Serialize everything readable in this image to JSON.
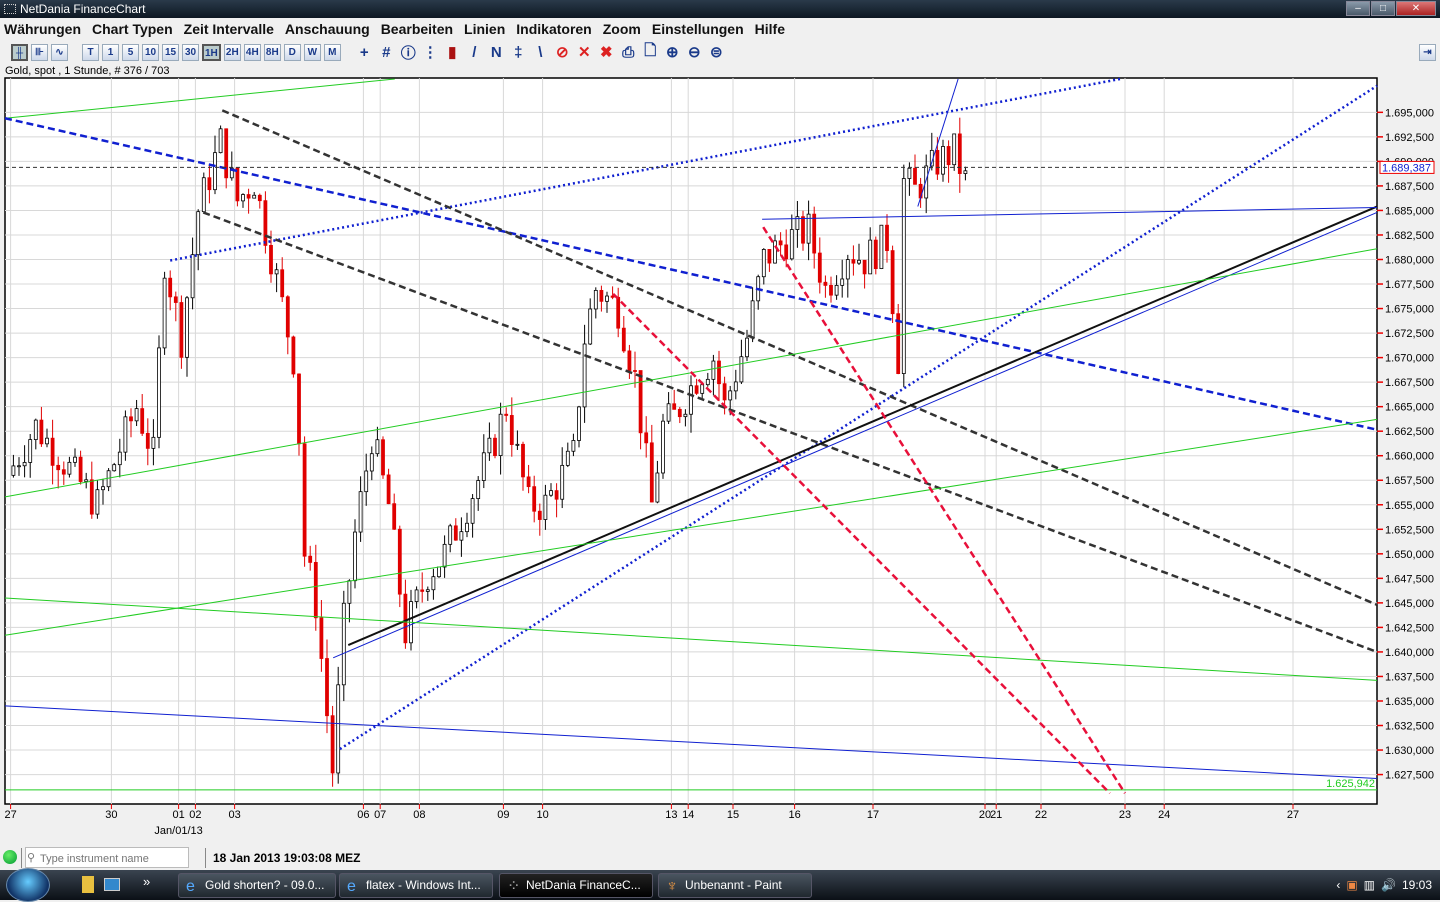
{
  "window": {
    "title": "NetDania FinanceChart",
    "min": "–",
    "max": "□",
    "close": "✕"
  },
  "menu": [
    "Währungen",
    "Chart Typen",
    "Zeit Intervalle",
    "Anschauung",
    "Bearbeiten",
    "Linien",
    "Indikatoren",
    "Zoom",
    "Einstellungen",
    "Hilfe"
  ],
  "toolbar": {
    "chart_types": [
      "candlestick-icon",
      "bar-chart-icon",
      "line-chart-icon"
    ],
    "intervals": [
      "T",
      "1",
      "5",
      "10",
      "15",
      "30",
      "1H",
      "2H",
      "4H",
      "8H",
      "D",
      "W",
      "M"
    ],
    "active_interval": "1H",
    "tools": [
      {
        "name": "crosshair-icon",
        "glyph": "+"
      },
      {
        "name": "grid-icon",
        "glyph": "#"
      },
      {
        "name": "info-icon",
        "glyph": "ⓘ"
      },
      {
        "name": "grid-lines-icon",
        "glyph": "⋮"
      },
      {
        "name": "volume-icon",
        "glyph": "▮"
      },
      {
        "name": "trendline-icon",
        "glyph": "/"
      },
      {
        "name": "trendline-2-icon",
        "glyph": "N"
      },
      {
        "name": "trendline-3-icon",
        "glyph": "‡"
      },
      {
        "name": "trendline-4-icon",
        "glyph": "\\"
      },
      {
        "name": "delete-line-icon",
        "glyph": "⊘"
      },
      {
        "name": "delete-icon",
        "glyph": "✕"
      },
      {
        "name": "delete-all-icon",
        "glyph": "✖"
      },
      {
        "name": "print-icon",
        "glyph": "⎙"
      },
      {
        "name": "print-preview-icon",
        "glyph": "🗋"
      },
      {
        "name": "zoom-in-icon",
        "glyph": "⊕"
      },
      {
        "name": "zoom-out-icon",
        "glyph": "⊖"
      },
      {
        "name": "zoom-reset-icon",
        "glyph": "⊜"
      }
    ]
  },
  "info_line": "Gold, spot , 1 Stunde, # 376 / 703",
  "status": {
    "search_placeholder": "Type instrument name",
    "timestamp": "18 Jan 2013 19:03:08 MEZ"
  },
  "taskbar": {
    "tasks": [
      "Gold shorten? - 09.0...",
      "flatex - Windows Int...",
      "NetDania FinanceC...",
      "Unbenannt - Paint"
    ],
    "time": "19:03"
  },
  "chart_data": {
    "type": "candlestick",
    "instrument": "Gold, spot",
    "interval": "1 Stunde",
    "ylim": [
      1.6245,
      1.6985
    ],
    "xlim": [
      0,
      245
    ],
    "y_ticks": [
      "1.695,000",
      "1.692,500",
      "1.690,000",
      "1.687,500",
      "1.685,000",
      "1.682,500",
      "1.680,000",
      "1.677,500",
      "1.675,000",
      "1.672,500",
      "1.670,000",
      "1.667,500",
      "1.665,000",
      "1.662,500",
      "1.660,000",
      "1.657,500",
      "1.655,000",
      "1.652,500",
      "1.650,000",
      "1.647,500",
      "1.645,000",
      "1.642,500",
      "1.640,000",
      "1.637,500",
      "1.635,000",
      "1.632,500",
      "1.630,000",
      "1.627,500"
    ],
    "y_tick_values": [
      1.695,
      1.6925,
      1.69,
      1.6875,
      1.685,
      1.6825,
      1.68,
      1.6775,
      1.675,
      1.6725,
      1.67,
      1.6675,
      1.665,
      1.6625,
      1.66,
      1.6575,
      1.655,
      1.6525,
      1.65,
      1.6475,
      1.645,
      1.6425,
      1.64,
      1.6375,
      1.635,
      1.6325,
      1.63,
      1.6275
    ],
    "x_ticks": [
      {
        "bar": 1,
        "label": "27"
      },
      {
        "bar": 19,
        "label": "30"
      },
      {
        "bar": 31,
        "label": "01"
      },
      {
        "bar": 34,
        "label": "02"
      },
      {
        "bar": 41,
        "label": "03"
      },
      {
        "bar": 64,
        "label": "06"
      },
      {
        "bar": 67,
        "label": "07"
      },
      {
        "bar": 74,
        "label": "08"
      },
      {
        "bar": 89,
        "label": "09"
      },
      {
        "bar": 96,
        "label": "10"
      },
      {
        "bar": 119,
        "label": "13"
      },
      {
        "bar": 122,
        "label": "14"
      },
      {
        "bar": 130,
        "label": "15"
      },
      {
        "bar": 141,
        "label": "16"
      },
      {
        "bar": 155,
        "label": "17"
      },
      {
        "bar": 175,
        "label": "20"
      },
      {
        "bar": 177,
        "label": "21"
      },
      {
        "bar": 185,
        "label": "22"
      },
      {
        "bar": 200,
        "label": "23"
      },
      {
        "bar": 207,
        "label": "24"
      },
      {
        "bar": 230,
        "label": "27"
      }
    ],
    "x_sublabel": {
      "bar": 31,
      "label": "Jan/01/13"
    },
    "current_price": 1.689387,
    "current_price_label": "1.689,387",
    "low_marker": 1.625942,
    "low_marker_label": "1.625,942",
    "price_path": [
      [
        1,
        1.658
      ],
      [
        6,
        1.663
      ],
      [
        17,
        1.655
      ],
      [
        24,
        1.665
      ],
      [
        27,
        1.66
      ],
      [
        29,
        1.68
      ],
      [
        32,
        1.672
      ],
      [
        35,
        1.685
      ],
      [
        39,
        1.692
      ],
      [
        42,
        1.686
      ],
      [
        45,
        1.688
      ],
      [
        49,
        1.678
      ],
      [
        52,
        1.67
      ],
      [
        53,
        1.662
      ],
      [
        54,
        1.65
      ],
      [
        56,
        1.645
      ],
      [
        59,
        1.628
      ],
      [
        61,
        1.643
      ],
      [
        63,
        1.652
      ],
      [
        66,
        1.662
      ],
      [
        69,
        1.655
      ],
      [
        72,
        1.642
      ],
      [
        76,
        1.648
      ],
      [
        79,
        1.65
      ],
      [
        83,
        1.655
      ],
      [
        87,
        1.66
      ],
      [
        90,
        1.665
      ],
      [
        94,
        1.655
      ],
      [
        97,
        1.655
      ],
      [
        102,
        1.66
      ],
      [
        104,
        1.672
      ],
      [
        106,
        1.677
      ],
      [
        110,
        1.675
      ],
      [
        113,
        1.668
      ],
      [
        116,
        1.655
      ],
      [
        118,
        1.663
      ],
      [
        120,
        1.664
      ],
      [
        124,
        1.668
      ],
      [
        127,
        1.67
      ],
      [
        129,
        1.665
      ],
      [
        133,
        1.672
      ],
      [
        136,
        1.68
      ],
      [
        140,
        1.682
      ],
      [
        144,
        1.683
      ],
      [
        147,
        1.677
      ],
      [
        151,
        1.681
      ],
      [
        154,
        1.68
      ],
      [
        158,
        1.682
      ],
      [
        160,
        1.67
      ],
      [
        161,
        1.688
      ],
      [
        163,
        1.687
      ],
      [
        167,
        1.69
      ],
      [
        170,
        1.691
      ],
      [
        172,
        1.688
      ]
    ],
    "lines": [
      {
        "from": [
          0,
          1.6944
        ],
        "to": [
          69.6,
          1.6984
        ],
        "color": "#22cc22",
        "style": "solid"
      },
      {
        "from": [
          0,
          1.6944
        ],
        "to": [
          244.6,
          1.6627
        ],
        "color": "#1020d0",
        "style": "dashed"
      },
      {
        "from": [
          29.5,
          1.6799
        ],
        "to": [
          199.1,
          1.6984
        ],
        "color": "#1020d0",
        "style": "dotted"
      },
      {
        "from": [
          59.8,
          1.6301
        ],
        "to": [
          245,
          1.6977
        ],
        "color": "#1020d0",
        "style": "dotted"
      },
      {
        "from": [
          38.8,
          1.6952
        ],
        "to": [
          245,
          1.6448
        ],
        "color": "#333333",
        "style": "dashed"
      },
      {
        "from": [
          35.4,
          1.6848
        ],
        "to": [
          245,
          1.64
        ],
        "color": "#333333",
        "style": "dashed"
      },
      {
        "from": [
          61.3,
          1.6407
        ],
        "to": [
          245,
          1.6854
        ],
        "color": "#111111",
        "style": "solid-thick"
      },
      {
        "from": [
          58.6,
          1.6394
        ],
        "to": [
          245,
          1.6848
        ],
        "color": "#1020d0",
        "style": "solid"
      },
      {
        "from": [
          135.2,
          1.6841
        ],
        "to": [
          245,
          1.6853
        ],
        "color": "#1020d0",
        "style": "solid"
      },
      {
        "from": [
          0,
          1.6558
        ],
        "to": [
          245,
          1.6811
        ],
        "color": "#22cc22",
        "style": "solid"
      },
      {
        "from": [
          0,
          1.6417
        ],
        "to": [
          245,
          1.6637
        ],
        "color": "#22cc22",
        "style": "solid"
      },
      {
        "from": [
          0,
          1.6455
        ],
        "to": [
          245,
          1.6371
        ],
        "color": "#22cc22",
        "style": "solid"
      },
      {
        "from": [
          0,
          1.6345
        ],
        "to": [
          245,
          1.6271
        ],
        "color": "#1020d0",
        "style": "solid"
      },
      {
        "from": [
          0,
          1.625942
        ],
        "to": [
          245,
          1.625942
        ],
        "color": "#22cc22",
        "style": "solid"
      },
      {
        "from": [
          108.6,
          1.6765
        ],
        "to": [
          197.3,
          1.6256
        ],
        "color": "#e8103a",
        "style": "dashed"
      },
      {
        "from": [
          135.4,
          1.6833
        ],
        "to": [
          200,
          1.6256
        ],
        "color": "#e8103a",
        "style": "dashed"
      },
      {
        "from": [
          163,
          1.6854
        ],
        "to": [
          170.2,
          1.6984
        ],
        "color": "#1020d0",
        "style": "solid"
      }
    ],
    "colors": {
      "up": "#000000",
      "down": "#e00000",
      "grid": "#d8d8d8"
    }
  }
}
